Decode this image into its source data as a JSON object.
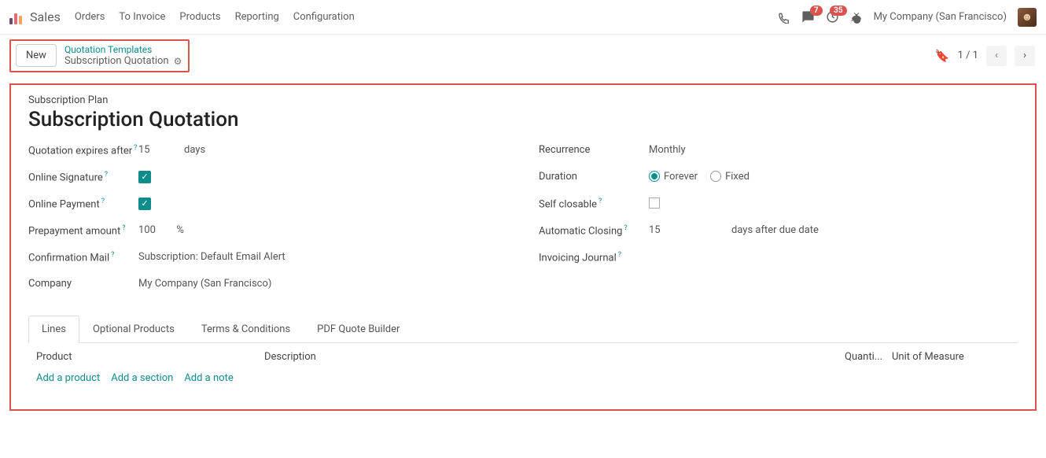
{
  "nav": {
    "app_title": "Sales",
    "items": [
      "Orders",
      "To Invoice",
      "Products",
      "Reporting",
      "Configuration"
    ],
    "msg_badge": "7",
    "activity_badge": "35",
    "company": "My Company (San Francisco)"
  },
  "breadcrumb": {
    "new_label": "New",
    "parent": "Quotation Templates",
    "current": "Subscription Quotation",
    "pager": "1 / 1"
  },
  "form": {
    "plan_label": "Subscription Plan",
    "plan_title": "Subscription Quotation",
    "left": {
      "expires_label": "Quotation expires after",
      "expires_value": "15",
      "expires_unit": "days",
      "signature_label": "Online Signature",
      "signature_checked": true,
      "payment_label": "Online Payment",
      "payment_checked": true,
      "prepay_label": "Prepayment amount",
      "prepay_value": "100",
      "prepay_unit": "%",
      "confirm_label": "Confirmation Mail",
      "confirm_value": "Subscription: Default Email Alert",
      "company_label": "Company",
      "company_value": "My Company (San Francisco)"
    },
    "right": {
      "recurrence_label": "Recurrence",
      "recurrence_value": "Monthly",
      "duration_label": "Duration",
      "duration_forever": "Forever",
      "duration_fixed": "Fixed",
      "duration_selected": "forever",
      "selfclose_label": "Self closable",
      "selfclose_checked": false,
      "autoclose_label": "Automatic Closing",
      "autoclose_value": "15",
      "autoclose_unit": "days after due date",
      "journal_label": "Invoicing Journal"
    }
  },
  "tabs": [
    "Lines",
    "Optional Products",
    "Terms & Conditions",
    "PDF Quote Builder"
  ],
  "grid": {
    "headers": {
      "product": "Product",
      "description": "Description",
      "quantity": "Quanti...",
      "uom": "Unit of Measure"
    },
    "actions": {
      "add_product": "Add a product",
      "add_section": "Add a section",
      "add_note": "Add a note"
    }
  }
}
